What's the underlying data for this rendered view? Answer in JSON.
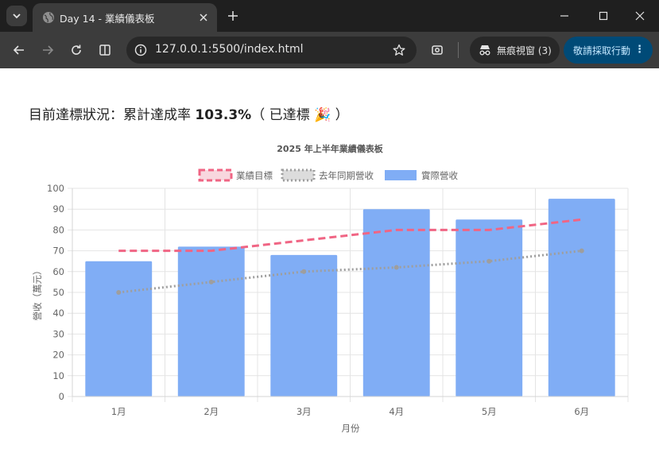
{
  "browser": {
    "tab_title": "Day 14 - 業績儀表板",
    "url": "127.0.0.1:5500/index.html",
    "incognito_label": "無痕視窗 (3)",
    "action_label": "敬請採取行動"
  },
  "page": {
    "status_prefix": "目前達標狀況：累計達成率 ",
    "status_rate": "103.3%",
    "status_suffix": "（ 已達標 🎉 ）"
  },
  "colors": {
    "bar": "#80adf5",
    "target_line": "#f06584",
    "last_year_line": "#9e9e9e"
  },
  "chart_data": {
    "type": "bar",
    "title": "2025 年上半年業績儀表板",
    "xlabel": "月份",
    "ylabel": "營收（萬元）",
    "ylim": [
      0,
      100
    ],
    "yticks": [
      0,
      10,
      20,
      30,
      40,
      50,
      60,
      70,
      80,
      90,
      100
    ],
    "grid": true,
    "legend_position": "top",
    "categories": [
      "1月",
      "2月",
      "3月",
      "4月",
      "5月",
      "6月"
    ],
    "series": [
      {
        "name": "業績目標",
        "type": "line",
        "style": "dashed",
        "values": [
          70,
          70,
          75,
          80,
          80,
          85
        ]
      },
      {
        "name": "去年同期營收",
        "type": "line",
        "style": "dotted",
        "values": [
          50,
          55,
          60,
          62,
          65,
          70
        ]
      },
      {
        "name": "實際營收",
        "type": "bar",
        "values": [
          65,
          72,
          68,
          90,
          85,
          95
        ]
      }
    ]
  }
}
